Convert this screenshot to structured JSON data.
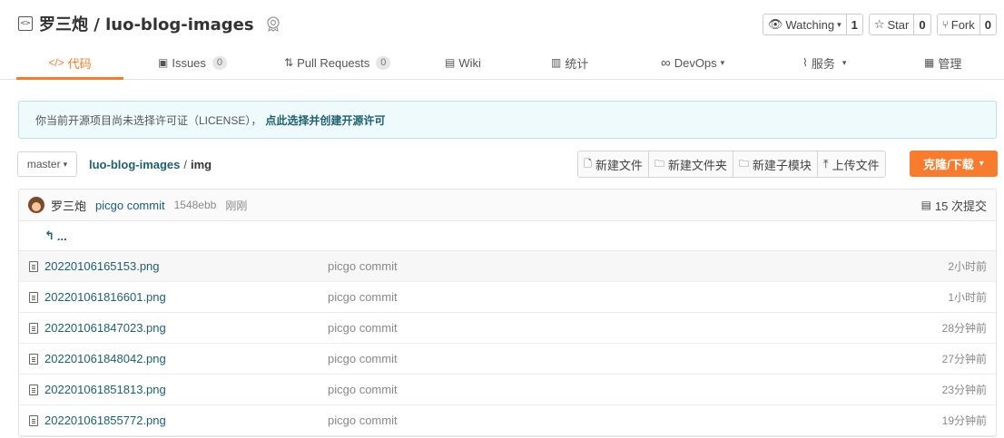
{
  "repo": {
    "title": "罗三炮 / luo-blog-images",
    "repo_icon": "code-icon",
    "badge_icon": "gvp-badge-icon"
  },
  "actions": {
    "watch": {
      "label": "Watching",
      "count": "1"
    },
    "star": {
      "label": "Star",
      "count": "0"
    },
    "fork": {
      "label": "Fork",
      "count": "0"
    }
  },
  "tabs": [
    {
      "label": "代码",
      "icon": "code-icon",
      "active": true
    },
    {
      "label": "Issues",
      "count": "0",
      "icon": "issue-icon"
    },
    {
      "label": "Pull Requests",
      "count": "0",
      "icon": "pull-request-icon"
    },
    {
      "label": "Wiki",
      "icon": "book-icon"
    },
    {
      "label": "统计",
      "icon": "bar-chart-icon"
    },
    {
      "label": "DevOps",
      "icon": "infinity-icon"
    },
    {
      "label": "服务",
      "icon": "pulse-icon"
    },
    {
      "label": "管理",
      "icon": "settings-doc-icon"
    }
  ],
  "notice": {
    "text": "你当前开源项目尚未选择许可证（LICENSE），",
    "link": "点此选择并创建开源许可"
  },
  "branch": {
    "name": "master"
  },
  "breadcrumb": {
    "repo": "luo-blog-images",
    "sep": "/",
    "dir": "img"
  },
  "buttons": {
    "new_file": "新建文件",
    "new_folder": "新建文件夹",
    "new_submodule": "新建子模块",
    "upload": "上传文件",
    "clone": "克隆/下载"
  },
  "commit": {
    "author": "罗三炮",
    "message": "picgo commit",
    "hash": "1548ebb",
    "time": "刚刚",
    "total": "15 次提交"
  },
  "up_dir": "...",
  "files": [
    {
      "name": "20220106165153.png",
      "message": "picgo commit",
      "time": "2小时前"
    },
    {
      "name": "202201061816601.png",
      "message": "picgo commit",
      "time": "1小时前"
    },
    {
      "name": "202201061847023.png",
      "message": "picgo commit",
      "time": "28分钟前"
    },
    {
      "name": "202201061848042.png",
      "message": "picgo commit",
      "time": "27分钟前"
    },
    {
      "name": "202201061851813.png",
      "message": "picgo commit",
      "time": "23分钟前"
    },
    {
      "name": "202201061855772.png",
      "message": "picgo commit",
      "time": "19分钟前"
    }
  ],
  "colors": {
    "accent": "#f97c2e",
    "link": "#1e5f70"
  }
}
